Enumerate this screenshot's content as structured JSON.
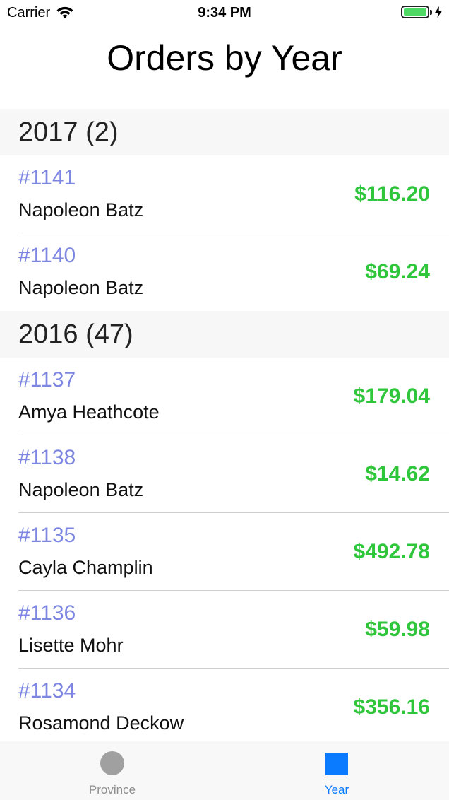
{
  "status_bar": {
    "carrier": "Carrier",
    "time": "9:34 PM"
  },
  "nav": {
    "title": "Orders by Year"
  },
  "sections": [
    {
      "header": "2017 (2)",
      "rows": [
        {
          "id": "#1141",
          "name": "Napoleon Batz",
          "amount": "$116.20"
        },
        {
          "id": "#1140",
          "name": "Napoleon Batz",
          "amount": "$69.24"
        }
      ]
    },
    {
      "header": "2016 (47)",
      "rows": [
        {
          "id": "#1137",
          "name": "Amya Heathcote",
          "amount": "$179.04"
        },
        {
          "id": "#1138",
          "name": "Napoleon Batz",
          "amount": "$14.62"
        },
        {
          "id": "#1135",
          "name": "Cayla Champlin",
          "amount": "$492.78"
        },
        {
          "id": "#1136",
          "name": "Lisette Mohr",
          "amount": "$59.98"
        },
        {
          "id": "#1134",
          "name": "Rosamond Deckow",
          "amount": "$356.16"
        }
      ]
    }
  ],
  "tabs": [
    {
      "label": "Province",
      "icon": "circle-icon",
      "active": false
    },
    {
      "label": "Year",
      "icon": "square-icon",
      "active": true
    }
  ],
  "colors": {
    "order_id": "#7d86e1",
    "amount": "#2fc63c",
    "active_tab": "#0a7aff",
    "inactive_tab": "#8e8e8e",
    "section_header_bg": "#f7f7f7",
    "battery_fill": "#4cd964"
  }
}
